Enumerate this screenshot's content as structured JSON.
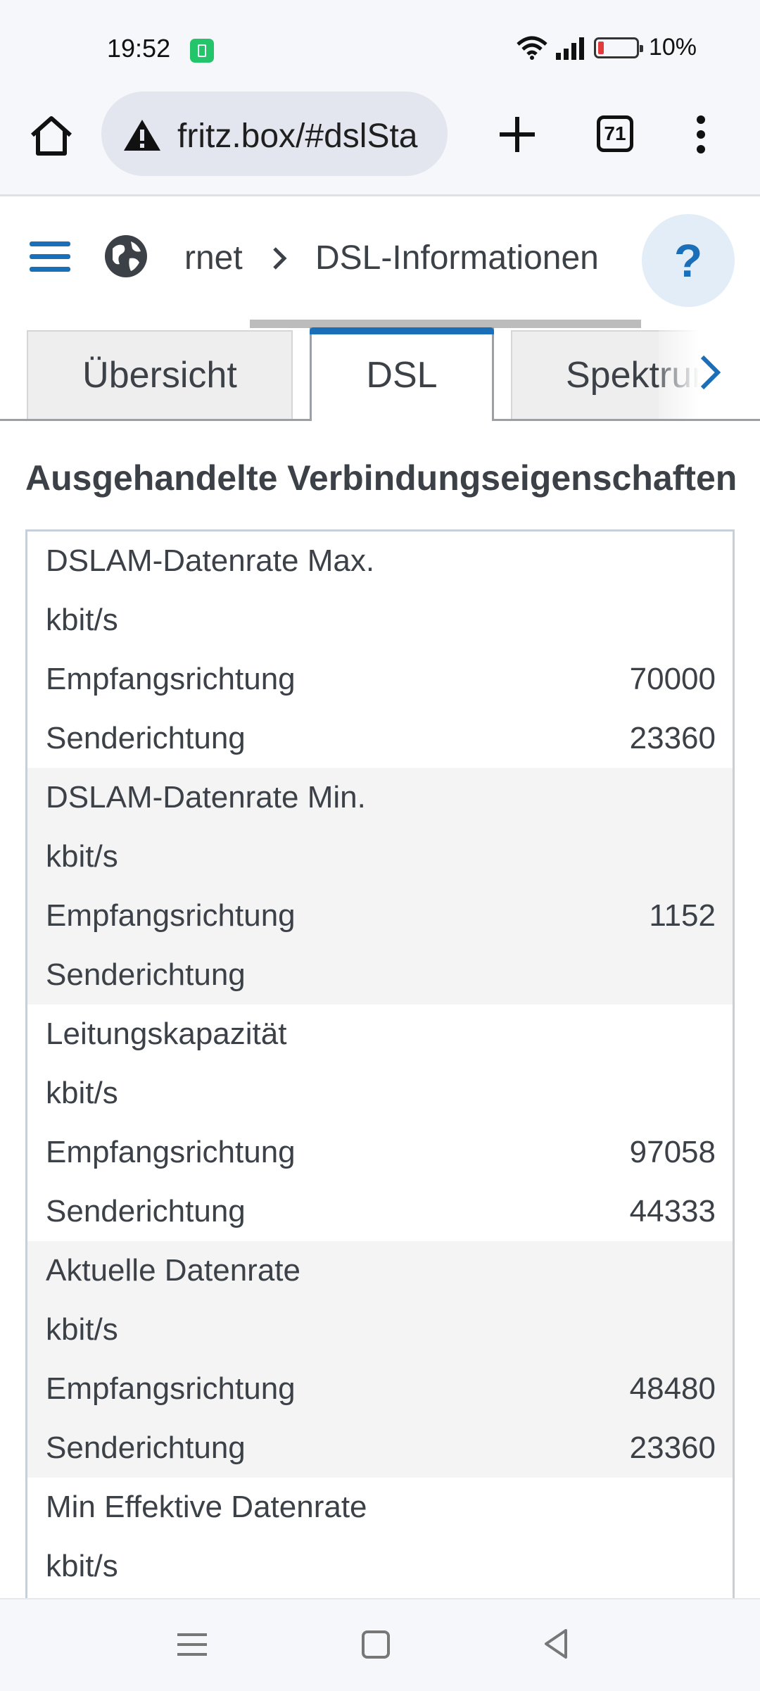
{
  "status_bar": {
    "time": "19:52",
    "battery_pct": "10%"
  },
  "browser": {
    "url": "fritz.box/#dslSta",
    "tab_count": "71"
  },
  "breadcrumb": {
    "previous": "rnet",
    "current": "DSL-Informationen",
    "help_label": "?"
  },
  "tabs": [
    {
      "label": "Übersicht"
    },
    {
      "label": "DSL"
    },
    {
      "label": "Spektrum"
    }
  ],
  "section": {
    "title": "Ausgehandelte Verbindungseigenschaften",
    "groups": [
      {
        "title": "DSLAM-Datenrate Max.",
        "unit": "kbit/s",
        "rows": [
          {
            "label": "Empfangsrichtung",
            "value": "70000"
          },
          {
            "label": "Senderichtung",
            "value": "23360"
          }
        ]
      },
      {
        "title": "DSLAM-Datenrate Min.",
        "unit": "kbit/s",
        "rows": [
          {
            "label": "Empfangsrichtung",
            "value": "1152"
          },
          {
            "label": "Senderichtung",
            "value": ""
          }
        ]
      },
      {
        "title": "Leitungskapazität",
        "unit": "kbit/s",
        "rows": [
          {
            "label": "Empfangsrichtung",
            "value": "97058"
          },
          {
            "label": "Senderichtung",
            "value": "44333"
          }
        ]
      },
      {
        "title": "Aktuelle Datenrate",
        "unit": "kbit/s",
        "rows": [
          {
            "label": "Empfangsrichtung",
            "value": "48480"
          },
          {
            "label": "Senderichtung",
            "value": "23360"
          }
        ]
      },
      {
        "title": "Min Effektive Datenrate",
        "unit": "kbit/s",
        "rows": []
      }
    ]
  },
  "icons": {
    "home": "home-icon",
    "warning": "warning-icon",
    "plus": "plus-icon",
    "menu": "more-vert-icon",
    "hamburger": "hamburger-icon",
    "globe": "globe-icon",
    "chevron": "chevron-right-icon"
  },
  "colors": {
    "accent": "#1a6fb8",
    "help_bg": "#e2edf7",
    "table_border": "#c7cfd8",
    "shaded_row": "#f4f4f4"
  }
}
